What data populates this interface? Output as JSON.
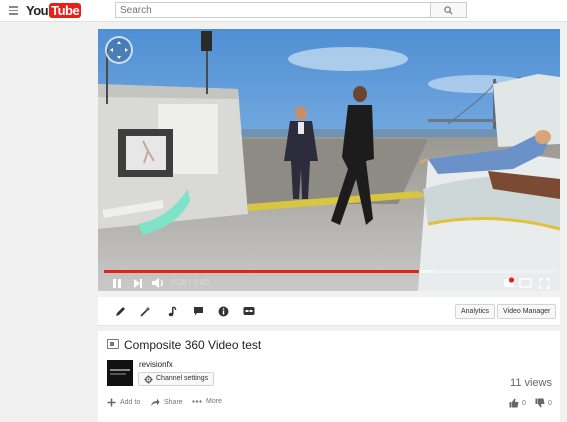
{
  "masthead": {
    "logo_you": "You",
    "logo_tube": "Tube",
    "search_placeholder": "Search",
    "icons": {
      "menu": "hamburger-icon",
      "search": "magnifier-icon"
    }
  },
  "player": {
    "time_current": "0:28",
    "time_separator": " / ",
    "time_total": "0:40",
    "progress_played_fraction": 0.7,
    "progress_loaded_fraction": 0.73,
    "colors": {
      "progress": "#e62117",
      "sky": "#7fb4e6"
    },
    "icons": {
      "nav": "360-navigation-icon",
      "play_pause": "pause-icon",
      "next": "next-icon",
      "volume": "volume-icon",
      "spherical": "360-badge-icon",
      "theater": "theater-mode-icon",
      "fullscreen": "fullscreen-icon"
    }
  },
  "toolbar": {
    "tools": [
      "pencil-icon",
      "magic-wand-icon",
      "music-note-icon",
      "annotation-icon",
      "info-icon",
      "cc-icon"
    ],
    "analytics_label": "Analytics",
    "video_manager_label": "Video Manager"
  },
  "info": {
    "title": "Composite 360 Video test",
    "channel_name": "revisionfx",
    "channel_settings_label": "Channel settings",
    "view_count": "11 views",
    "add_to_label": "Add to",
    "share_label": "Share",
    "more_label": "More",
    "likes": "0",
    "dislikes": "0"
  }
}
